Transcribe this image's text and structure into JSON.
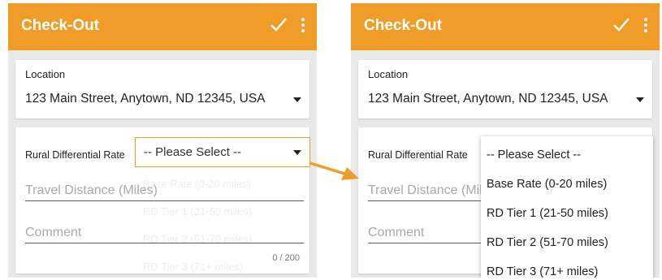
{
  "screen_before": {
    "appbar": {
      "title": "Check-Out",
      "check_icon": "check-icon",
      "more_icon": "more-vertical-icon"
    },
    "location": {
      "label": "Location",
      "value": "123 Main Street, Anytown, ND 12345, USA"
    },
    "rate": {
      "label": "Rural Differential Rate",
      "value": "-- Please Select --"
    },
    "travel_distance": {
      "placeholder": "Travel Distance (Miles)"
    },
    "comment": {
      "placeholder": "Comment",
      "counter": "0 / 200"
    }
  },
  "screen_after": {
    "appbar": {
      "title": "Check-Out",
      "check_icon": "check-icon",
      "more_icon": "more-vertical-icon"
    },
    "location": {
      "label": "Location",
      "value": "123 Main Street, Anytown, ND 12345, USA"
    },
    "rate": {
      "label": "Rural Differential Rate",
      "options": [
        "-- Please Select --",
        "Base Rate (0-20 miles)",
        "RD Tier 1 (21-50 miles)",
        "RD Tier 2 (51-70 miles)",
        "RD Tier 3 (71+ miles)"
      ]
    },
    "travel_distance": {
      "placeholder": "Travel Distance (Miles)"
    },
    "comment": {
      "placeholder": "Comment"
    }
  },
  "colors": {
    "accent": "#ef9d28",
    "background": "#e9e9e9",
    "card": "#ffffff",
    "placeholder": "#a9a9a9"
  }
}
